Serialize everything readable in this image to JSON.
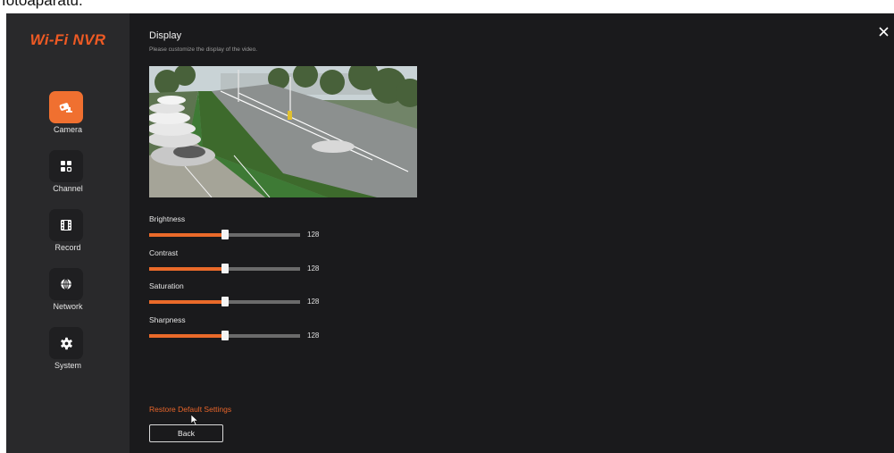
{
  "caption": "fotoaparátu.",
  "brand": {
    "name": "Wi-Fi NVR",
    "color": "#ee5a24"
  },
  "sidebar": {
    "items": [
      {
        "label": "Camera",
        "icon": "camera-icon",
        "active": true
      },
      {
        "label": "Channel",
        "icon": "channel-grid-icon",
        "active": false
      },
      {
        "label": "Record",
        "icon": "film-icon",
        "active": false
      },
      {
        "label": "Network",
        "icon": "globe-icon",
        "active": false
      },
      {
        "label": "System",
        "icon": "gear-icon",
        "active": false
      }
    ]
  },
  "header": {
    "title": "Display",
    "subtitle": "Please customize the display of the video.",
    "close_icon": "close-icon"
  },
  "sliders": [
    {
      "label": "Brightness",
      "value": "128",
      "fraction": 0.5
    },
    {
      "label": "Contrast",
      "value": "128",
      "fraction": 0.5
    },
    {
      "label": "Saturation",
      "value": "128",
      "fraction": 0.5
    },
    {
      "label": "Sharpness",
      "value": "128",
      "fraction": 0.5
    }
  ],
  "footer": {
    "restore_label": "Restore Default Settings",
    "back_label": "Back"
  },
  "colors": {
    "accent": "#ea6a2a",
    "background": "#1a1a1c",
    "sidebar": "#29292b",
    "track": "#6b6b6b"
  }
}
